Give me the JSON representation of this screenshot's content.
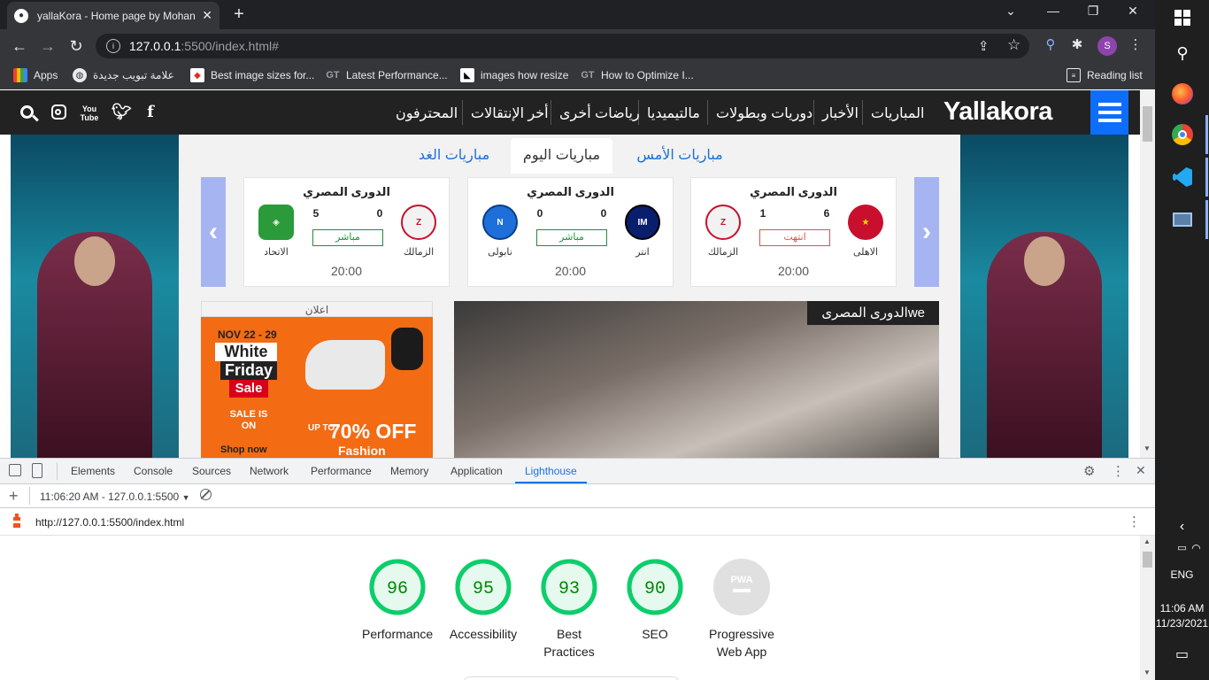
{
  "browser": {
    "tab_title": "yallaKora - Home page by Mohan",
    "url_host": "127.0.0.1",
    "url_rest": ":5500/index.html#",
    "bookmarks": [
      {
        "label": "Apps",
        "icon": "apps-grid-icon"
      },
      {
        "label": "علامة تبويب جديدة",
        "icon": "globe-icon"
      },
      {
        "label": "Best image sizes for...",
        "icon": "bookmark-site-icon"
      },
      {
        "label": "Latest Performance...",
        "icon": "gt-icon"
      },
      {
        "label": "images how resize",
        "icon": "bookmark-site-icon"
      },
      {
        "label": "How to Optimize I...",
        "icon": "gt-icon"
      }
    ],
    "reading_list": "Reading list",
    "profile_initial": "S"
  },
  "site": {
    "logo": "Yallakora",
    "nav": [
      "المباريات",
      "الأخبار",
      "دوريات وبطولات",
      "مالتيميديا",
      "رياضات أخرى",
      "أخر الإنتقالات",
      "المحترفون"
    ],
    "match_tabs": [
      "مباريات الأمس",
      "مباريات اليوم",
      "مباريات الغد"
    ],
    "matches": [
      {
        "league": "الدورى المصري",
        "home": "الاهلى",
        "away": "الزمالك",
        "home_score": "6",
        "away_score": "1",
        "status": "انتهت",
        "time": "20:00",
        "status_color": "#d9534f",
        "home_color": "#c8102e",
        "away_color": "#e8e8e8"
      },
      {
        "league": "الدورى المصري",
        "home": "انتر",
        "away": "نابولى",
        "home_score": "0",
        "away_score": "0",
        "status": "مباشر",
        "time": "20:00",
        "status_color": "#1e8e3e",
        "home_color": "#0a1e6e",
        "away_color": "#1e6fd9"
      },
      {
        "league": "الدورى المصري",
        "home": "الزمالك",
        "away": "الاتحاد",
        "home_score": "0",
        "away_score": "5",
        "status": "مباشر",
        "time": "20:00",
        "status_color": "#1e8e3e",
        "home_color": "#e8e8e8",
        "away_color": "#2a9a3a"
      }
    ],
    "ad_label": "اعلان",
    "ad": {
      "date": "NOV 22 - 29",
      "line1": "White",
      "line2": "Friday",
      "line3": "Sale",
      "sale_text": "SALE IS ON",
      "shop": "Shop now",
      "upto": "UP TO",
      "offer": "70% OFF",
      "category": "Fashion"
    },
    "news_badge": "الدورى المصرىwe"
  },
  "devtools": {
    "tabs": [
      "Elements",
      "Console",
      "Sources",
      "Network",
      "Performance",
      "Memory",
      "Application",
      "Lighthouse"
    ],
    "active_tab": "Lighthouse",
    "report_time": "11:06:20 AM - 127.0.0.1:5500",
    "report_url": "http://127.0.0.1:5500/index.html",
    "scores": [
      {
        "label": "Performance",
        "value": 96
      },
      {
        "label": "Accessibility",
        "value": 95
      },
      {
        "label": "Best Practices",
        "value": 93
      },
      {
        "label": "SEO",
        "value": 90
      }
    ],
    "pwa_label": "Progressive Web App",
    "pwa_badge": "PWA",
    "good_color": "#0cce6b",
    "good_text_color": "#008800"
  },
  "taskbar": {
    "lang": "ENG",
    "time": "11:06 AM",
    "date": "11/23/2021"
  }
}
